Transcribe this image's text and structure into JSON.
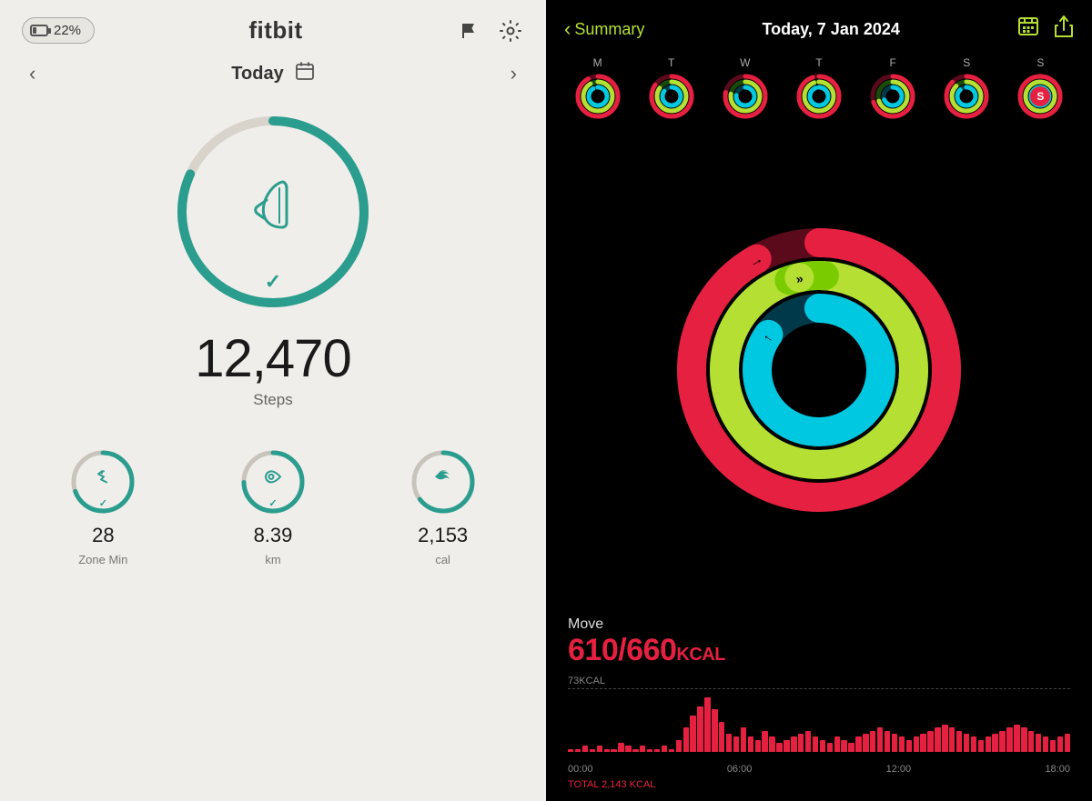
{
  "fitbit": {
    "battery_pct": "22%",
    "title": "fitbit",
    "nav": {
      "today": "Today"
    },
    "steps": {
      "value": "12,470",
      "label": "Steps",
      "ring_progress": 0.82
    },
    "metrics": [
      {
        "id": "zone-min",
        "value": "28",
        "label": "Zone Min",
        "progress": 0.7,
        "icon": "⚡"
      },
      {
        "id": "km",
        "value": "8.39",
        "label": "km",
        "progress": 0.75,
        "icon": "📍"
      },
      {
        "id": "cal",
        "value": "2,153",
        "label": "cal",
        "progress": 0.65,
        "icon": "🔥"
      }
    ]
  },
  "apple": {
    "back_label": "Summary",
    "date": "Today, 7 Jan 2024",
    "weekdays": [
      {
        "label": "M",
        "filled": true
      },
      {
        "label": "T",
        "filled": true
      },
      {
        "label": "W",
        "filled": true
      },
      {
        "label": "T",
        "filled": true
      },
      {
        "label": "F",
        "filled": true
      },
      {
        "label": "S",
        "filled": true
      },
      {
        "label": "S",
        "active": true
      }
    ],
    "move": {
      "label": "Move",
      "current": "610",
      "goal": "660",
      "unit": "KCAL"
    },
    "chart": {
      "kcal_line": "73KCAL",
      "total": "TOTAL 2,143 KCAL",
      "time_labels": [
        "00:00",
        "06:00",
        "12:00",
        "18:00"
      ],
      "bars": [
        1,
        1,
        2,
        1,
        2,
        1,
        1,
        3,
        2,
        1,
        2,
        1,
        1,
        2,
        1,
        4,
        8,
        12,
        15,
        18,
        14,
        10,
        6,
        5,
        8,
        5,
        4,
        7,
        5,
        3,
        4,
        5,
        6,
        7,
        5,
        4,
        3,
        5,
        4,
        3,
        5,
        6,
        7,
        8,
        7,
        6,
        5,
        4,
        5,
        6,
        7,
        8,
        9,
        8,
        7,
        6,
        5,
        4,
        5,
        6,
        7,
        8,
        9,
        8,
        7,
        6,
        5,
        4,
        5,
        6
      ]
    }
  }
}
